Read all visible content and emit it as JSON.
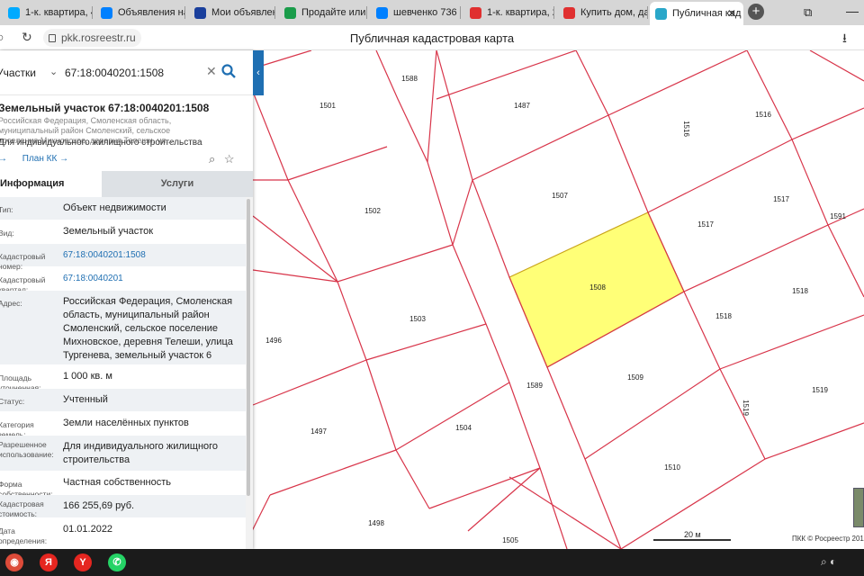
{
  "browser": {
    "tabs": [
      {
        "title": "1-к. квартира, 4",
        "color": "#00aaff",
        "active": false
      },
      {
        "title": "Объявления на",
        "color": "#0080ff",
        "active": false
      },
      {
        "title": "Мои объявлен",
        "color": "#1a3f9c",
        "active": false
      },
      {
        "title": "Продайте или с",
        "color": "#1a9c4a",
        "active": false
      },
      {
        "title": "шевченко 736",
        "color": "#0080ff",
        "active": false
      },
      {
        "title": "1-к. квартира, 2",
        "color": "#e03030",
        "active": false
      },
      {
        "title": "Купить дом, да",
        "color": "#e03030",
        "active": false
      },
      {
        "title": "Публичная кад",
        "color": "#2aa7c9",
        "active": true
      }
    ],
    "new_tab_icon": "plus-icon",
    "url": "pkk.rosreestr.ru",
    "page_title": "Публичная кадастровая карта"
  },
  "search": {
    "category": "Участки",
    "query": "67:18:0040201:1508",
    "clear_icon": "close-icon",
    "search_icon": "search-icon"
  },
  "parcel": {
    "title": "Земельный участок 67:18:0040201:1508",
    "address_short": "Российская Федерация, Смоленская область, муниципальный район Смоленский, сельское поселение Михновское, деревня Телеши, ул...",
    "usage": "Для индивидуального жилищного строительства",
    "link1": "→",
    "link2": "План КК →"
  },
  "tabs": {
    "info": "Информация",
    "services": "Услуги"
  },
  "rows": [
    {
      "label": "Тип:",
      "value": "Объект недвижимости",
      "alt": true,
      "link": false
    },
    {
      "label": "Вид:",
      "value": "Земельный участок",
      "alt": false,
      "link": false
    },
    {
      "label": "Кадастровый номер:",
      "value": "67:18:0040201:1508",
      "alt": true,
      "link": true
    },
    {
      "label": "Кадастровый квартал:",
      "value": "67:18:0040201",
      "alt": false,
      "link": true
    },
    {
      "label": "Адрес:",
      "value": "Российская Федерация, Смоленская область, муниципальный район Смоленский, сельское поселение Михновское, деревня Телеши, улица Тургенева, земельный участок 6",
      "alt": true,
      "link": false
    },
    {
      "label": "Площадь уточненная:",
      "value": "1 000 кв. м",
      "alt": false,
      "link": false
    },
    {
      "label": "Статус:",
      "value": "Учтенный",
      "alt": true,
      "link": false
    },
    {
      "label": "Категория земель:",
      "value": "Земли населённых пунктов",
      "alt": false,
      "link": false
    },
    {
      "label": "Разрешенное использование:",
      "value": "Для индивидуального жилищного строительства",
      "alt": true,
      "link": false
    },
    {
      "label": "Форма собственности:",
      "value": "Частная собственность",
      "alt": false,
      "link": false
    },
    {
      "label": "Кадастровая стоимость:",
      "value": "166 255,69 руб.",
      "alt": true,
      "link": false
    },
    {
      "label": "Дата определения:",
      "value": "01.01.2022",
      "alt": false,
      "link": false
    }
  ],
  "map": {
    "parcel_numbers": [
      "1588",
      "1501",
      "1487",
      "1516",
      "1516",
      "1507",
      "1502",
      "1517",
      "1517",
      "1591",
      "1508",
      "1518",
      "1518",
      "1503",
      "1496",
      "1589",
      "1509",
      "1519",
      "1519",
      "1497",
      "1504",
      "1510",
      "1498",
      "1505"
    ],
    "highlight_color": "#ffff77",
    "boundary_color": "#d8354a",
    "scale_label": "20 м",
    "copyright": "ПКК © Росреестр 201"
  },
  "taskbar": {
    "icons": [
      "chrome-icon",
      "yandex-icon",
      "yandex-browser-icon",
      "whatsapp-icon"
    ]
  }
}
